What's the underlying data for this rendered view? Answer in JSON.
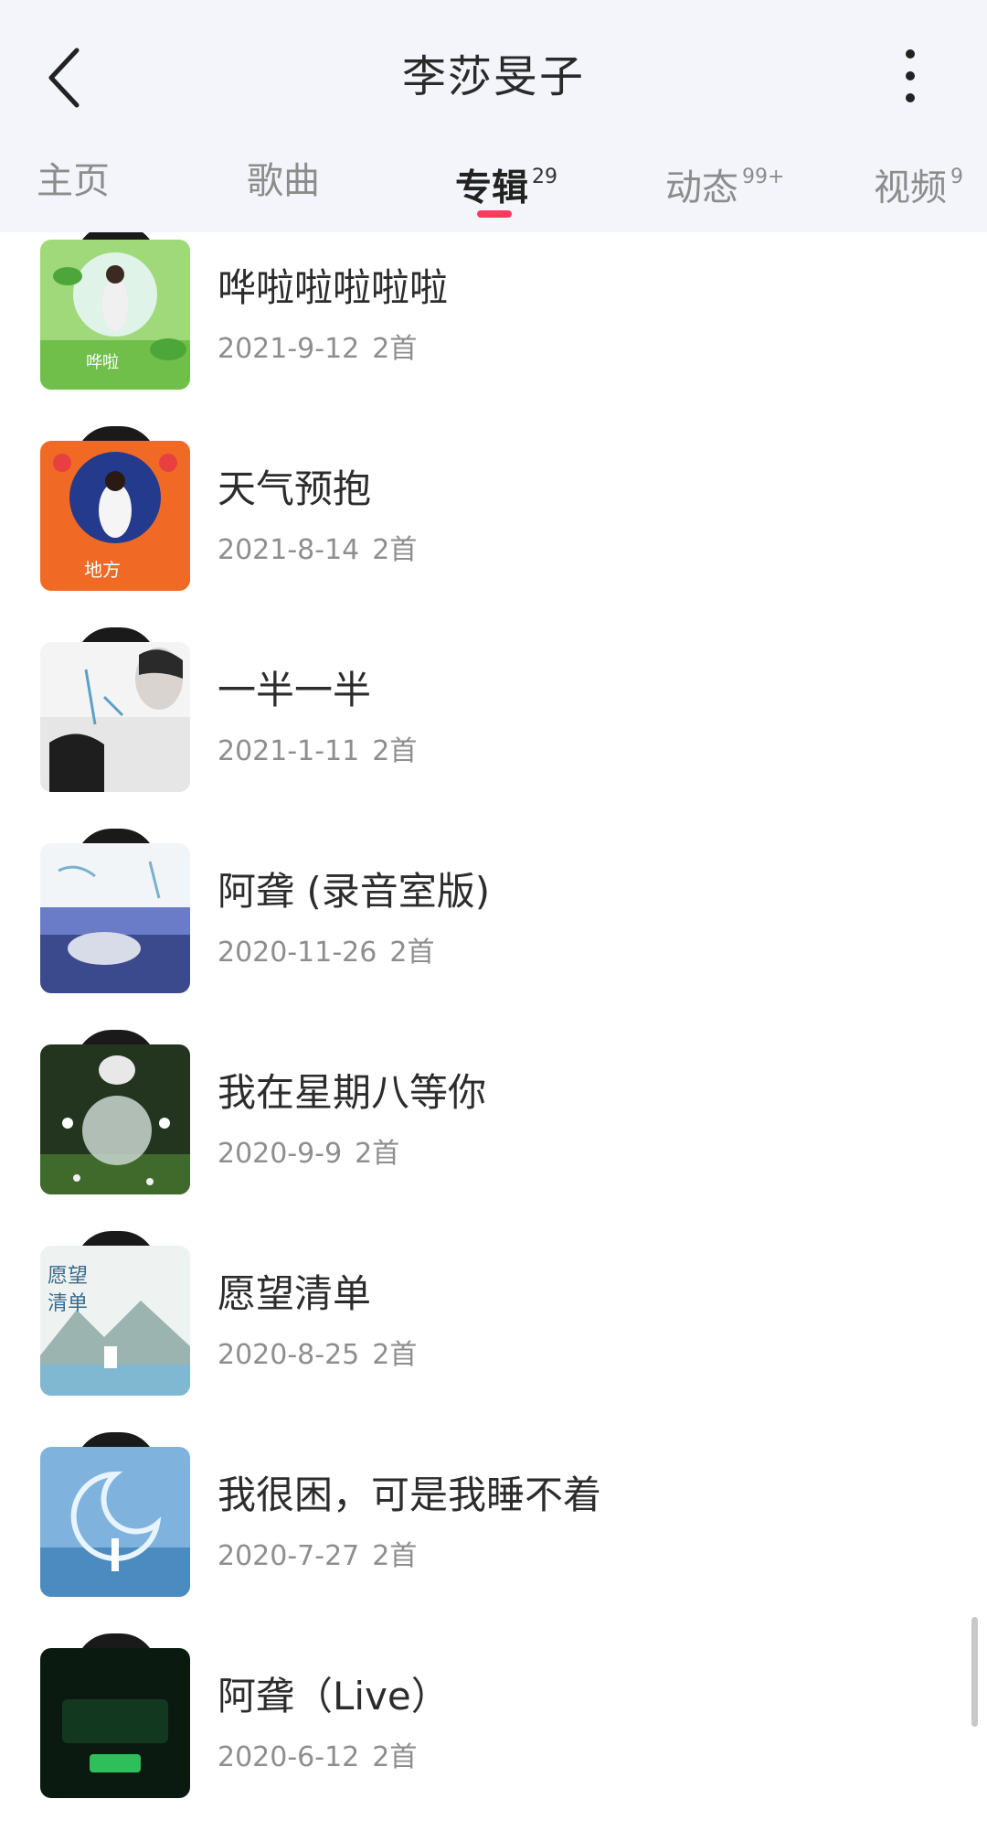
{
  "header": {
    "title": "李莎旻子",
    "back_icon": "chevron-left-icon",
    "more_icon": "vertical-dots-icon"
  },
  "tabs": [
    {
      "label": "主页",
      "badge": ""
    },
    {
      "label": "歌曲",
      "badge": ""
    },
    {
      "label": "专辑",
      "badge": "29",
      "active": true
    },
    {
      "label": "动态",
      "badge": "99+"
    },
    {
      "label": "视频",
      "badge": "9"
    }
  ],
  "colors": {
    "accent": "#ff3a5d",
    "header_bg": "#f3f5fa"
  },
  "albums": [
    {
      "title": "哗啦啦啦啦啦",
      "date": "2021-9-12",
      "count": "2首"
    },
    {
      "title": "天气预抱",
      "date": "2021-8-14",
      "count": "2首"
    },
    {
      "title": "一半一半",
      "date": "2021-1-11",
      "count": "2首"
    },
    {
      "title": "阿聋 (录音室版)",
      "date": "2020-11-26",
      "count": "2首"
    },
    {
      "title": "我在星期八等你",
      "date": "2020-9-9",
      "count": "2首"
    },
    {
      "title": "愿望清单",
      "date": "2020-8-25",
      "count": "2首"
    },
    {
      "title": "我很困，可是我睡不着",
      "date": "2020-7-27",
      "count": "2首"
    },
    {
      "title": "阿聋（Live）",
      "date": "2020-6-12",
      "count": "2首"
    }
  ]
}
